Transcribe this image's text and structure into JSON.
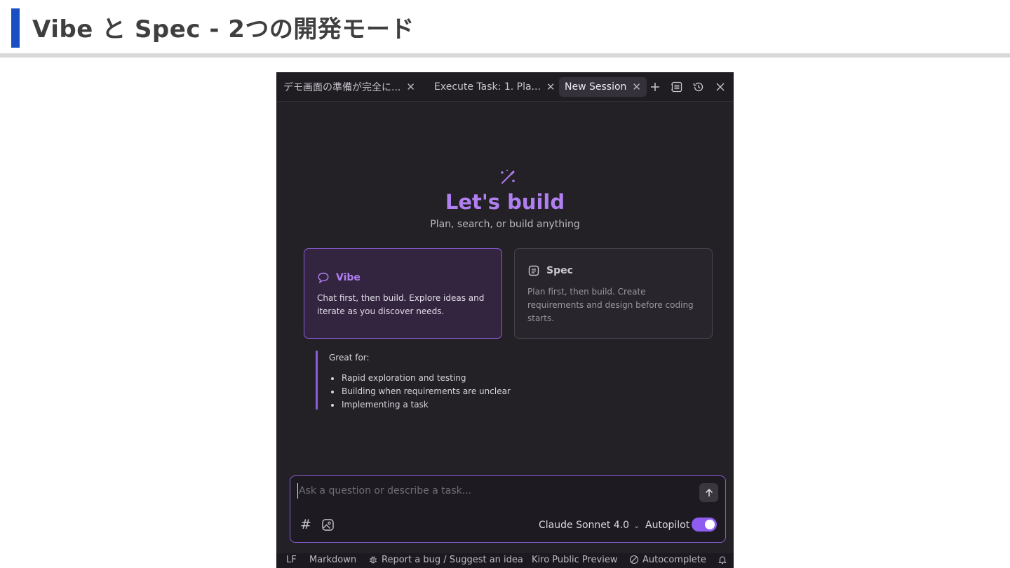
{
  "slide": {
    "title": "Vibe と Spec - 2つの開発モード",
    "accent_color": "#1a4fc4"
  },
  "tabs": [
    {
      "label": "デモ画面の準備が完全に...",
      "active": false
    },
    {
      "label": "Execute Task: 1. Pla...",
      "active": false
    },
    {
      "label": "New Session",
      "active": true
    }
  ],
  "toolbar_icons": [
    "plus-icon",
    "checklist-icon",
    "history-icon",
    "close-icon"
  ],
  "hero": {
    "icon": "magic-wand-icon",
    "title": "Let's build",
    "subtitle": "Plan, search, or build anything"
  },
  "modes": {
    "vibe": {
      "icon": "chat-bubble-icon",
      "title": "Vibe",
      "description": "Chat first, then build. Explore ideas and iterate as you discover needs.",
      "selected": true
    },
    "spec": {
      "icon": "document-icon",
      "title": "Spec",
      "description": "Plan first, then build. Create requirements and design before coding starts.",
      "selected": false
    }
  },
  "great_for": {
    "title": "Great for:",
    "items": [
      "Rapid exploration and testing",
      "Building when requirements are unclear",
      "Implementing a task"
    ]
  },
  "chat_input": {
    "placeholder": "Ask a question or describe a task...",
    "value": "",
    "model": "Claude Sonnet 4.0",
    "autopilot_label": "Autopilot",
    "autopilot_on": true
  },
  "statusbar": {
    "line_ending": "LF",
    "language": "Markdown",
    "report": "Report a bug / Suggest an idea",
    "preview": "Kiro Public Preview",
    "autocomplete": "Autocomplete"
  },
  "colors": {
    "accent": "#b07ff0",
    "toggle": "#8e5cf0",
    "background": "#232026"
  }
}
